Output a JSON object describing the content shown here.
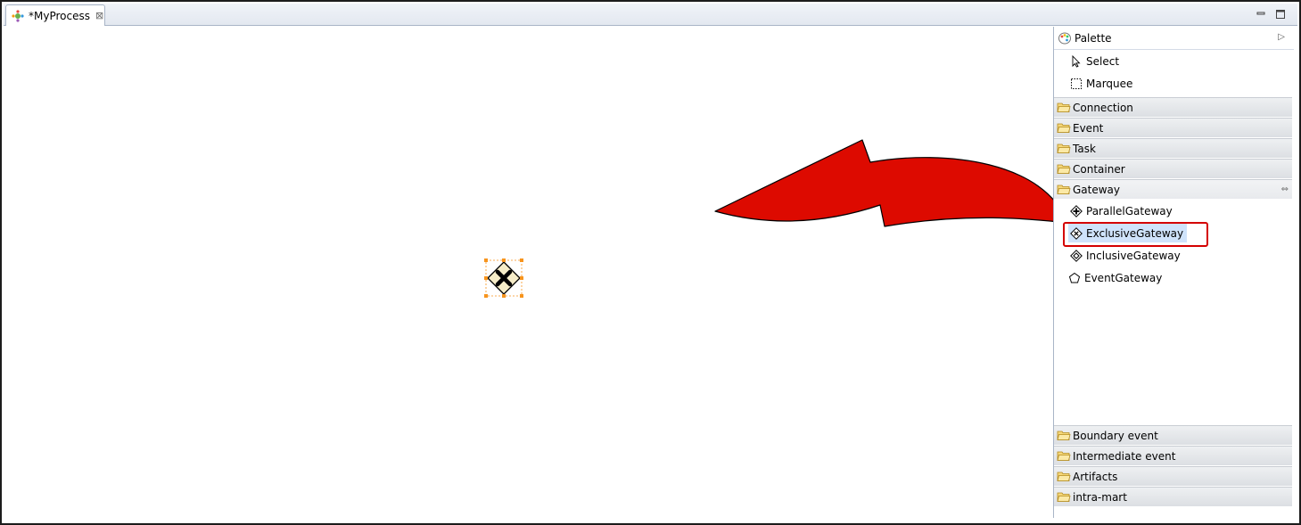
{
  "editor": {
    "tab_label": "*MyProcess",
    "close_glyph": "⊠"
  },
  "palette": {
    "title": "Palette",
    "collapse_glyph": "▷",
    "tools": [
      {
        "label": "Select",
        "icon": "pointer-icon"
      },
      {
        "label": "Marquee",
        "icon": "marquee-icon"
      }
    ],
    "drawers_top": [
      {
        "label": "Connection"
      },
      {
        "label": "Event"
      },
      {
        "label": "Task"
      },
      {
        "label": "Container"
      }
    ],
    "gateway_drawer": {
      "label": "Gateway",
      "pin_glyph": "⇔",
      "items": [
        {
          "label": "ParallelGateway",
          "icon": "parallel-gateway-icon"
        },
        {
          "label": "ExclusiveGateway",
          "icon": "exclusive-gateway-icon",
          "selected": true
        },
        {
          "label": "InclusiveGateway",
          "icon": "inclusive-gateway-icon"
        },
        {
          "label": "EventGateway",
          "icon": "event-gateway-icon"
        }
      ]
    },
    "drawers_bottom": [
      {
        "label": "Boundary event"
      },
      {
        "label": "Intermediate event"
      },
      {
        "label": "Artifacts"
      },
      {
        "label": "intra-mart"
      }
    ]
  },
  "colors": {
    "annotation_red": "#d40000",
    "selection_handle": "#f7941d",
    "gateway_fill": "#f5ecc8"
  }
}
